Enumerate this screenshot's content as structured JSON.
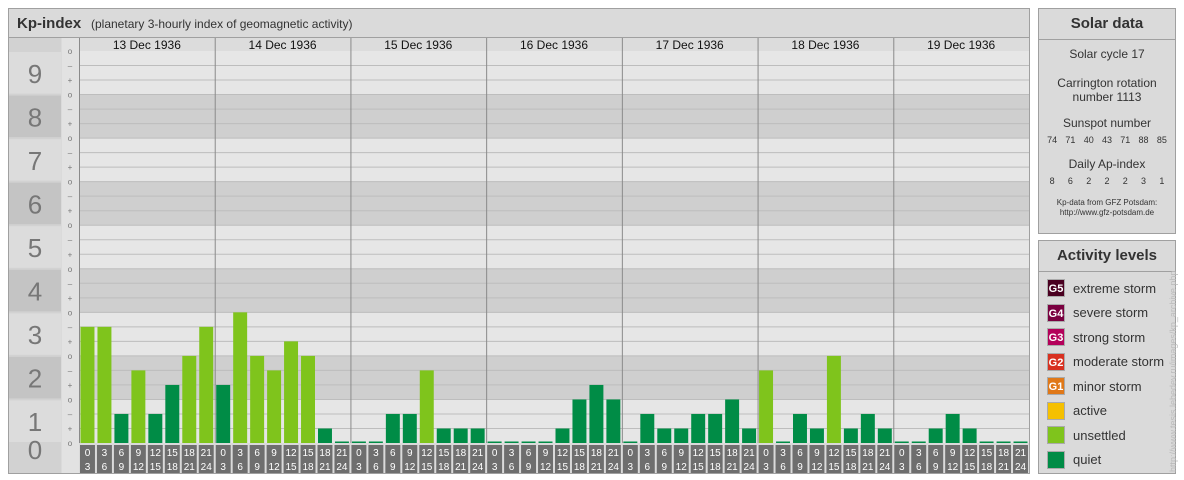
{
  "header": {
    "title": "Kp-index",
    "subtitle": "(planetary 3-hourly index of geomagnetic activity)"
  },
  "solar": {
    "title": "Solar data",
    "cycle": "Solar cycle 17",
    "carrington": "Carrington rotation number 1113",
    "sunspot_label": "Sunspot number",
    "sunspot_values": [
      "74",
      "71",
      "40",
      "43",
      "71",
      "88",
      "85"
    ],
    "ap_label": "Daily Ap-index",
    "ap_values": [
      "8",
      "6",
      "2",
      "2",
      "2",
      "3",
      "1"
    ],
    "credit_line1": "Kp-data from GFZ Potsdam:",
    "credit_line2": "http://www.gfz-potsdam.de"
  },
  "levels": {
    "title": "Activity levels",
    "items": [
      {
        "code": "G5",
        "label": "extreme storm",
        "color": "#4a0020"
      },
      {
        "code": "G4",
        "label": "severe storm",
        "color": "#7a0040"
      },
      {
        "code": "G3",
        "label": "strong storm",
        "color": "#b4005a"
      },
      {
        "code": "G2",
        "label": "moderate storm",
        "color": "#d83020"
      },
      {
        "code": "G1",
        "label": "minor storm",
        "color": "#e07818"
      },
      {
        "code": "",
        "label": "active",
        "color": "#f5c000"
      },
      {
        "code": "",
        "label": "unsettled",
        "color": "#7fc41c"
      },
      {
        "code": "",
        "label": "quiet",
        "color": "#008c46"
      }
    ]
  },
  "watermark": "http://www.tesis.lebedev.ru/images/kp_archive.php",
  "chart_data": {
    "type": "bar",
    "title": "Kp-index",
    "ylim": [
      0,
      9
    ],
    "y_ticks": [
      "0",
      "1",
      "2",
      "3",
      "4",
      "5",
      "6",
      "7",
      "8",
      "9"
    ],
    "minor_tick_labels": [
      "–",
      "o",
      "+"
    ],
    "days": [
      "13 Dec 1936",
      "14 Dec 1936",
      "15 Dec 1936",
      "16 Dec 1936",
      "17 Dec 1936",
      "18 Dec 1936",
      "19 Dec 1936"
    ],
    "interval_labels": [
      [
        "0",
        "3"
      ],
      [
        "3",
        "6"
      ],
      [
        "6",
        "9"
      ],
      [
        "9",
        "12"
      ],
      [
        "12",
        "15"
      ],
      [
        "15",
        "18"
      ],
      [
        "18",
        "21"
      ],
      [
        "21",
        "24"
      ]
    ],
    "values": [
      [
        2.667,
        2.667,
        0.667,
        1.667,
        0.667,
        1.333,
        2.0,
        2.667
      ],
      [
        1.333,
        3.0,
        2.0,
        1.667,
        2.333,
        2.0,
        0.333,
        0
      ],
      [
        0,
        0,
        0.667,
        0.667,
        1.667,
        0.333,
        0.333,
        0.333
      ],
      [
        0,
        0,
        0,
        0,
        0.333,
        1.0,
        1.333,
        1.0
      ],
      [
        0,
        0.667,
        0.333,
        0.333,
        0.667,
        0.667,
        1.0,
        0.333
      ],
      [
        1.667,
        0,
        0.667,
        0.333,
        2.0,
        0.333,
        0.667,
        0.333
      ],
      [
        0,
        0,
        0.333,
        0.667,
        0.333,
        0,
        0,
        0
      ]
    ],
    "colors": {
      "quiet": "#008c46",
      "unsettled": "#7fc41c"
    },
    "grid": true
  }
}
